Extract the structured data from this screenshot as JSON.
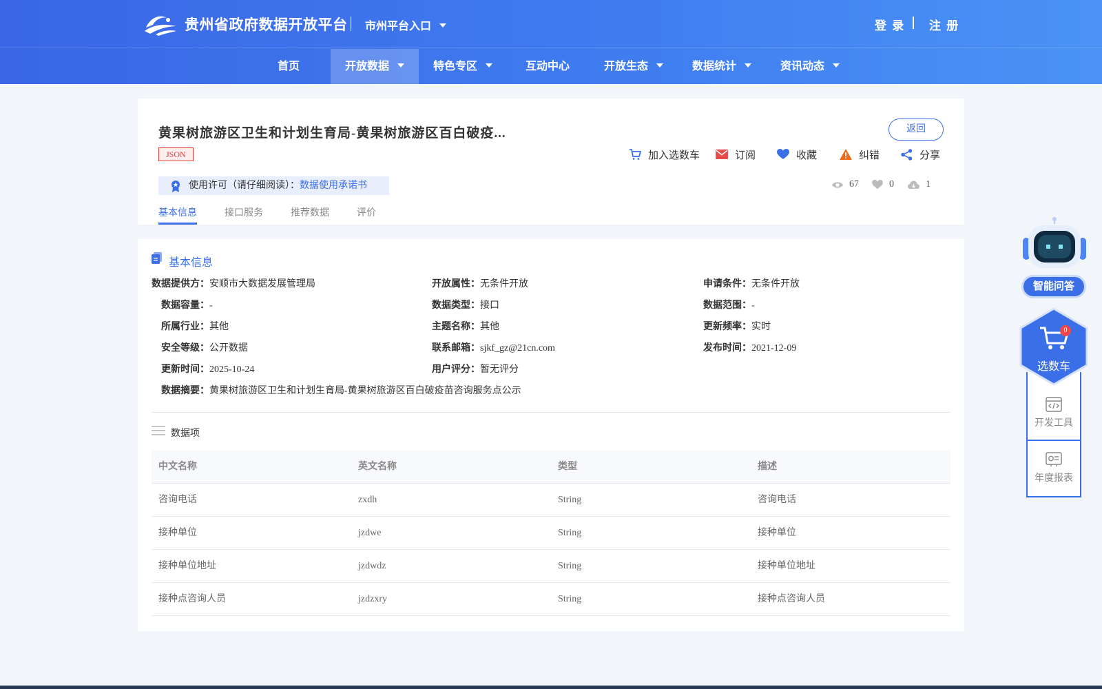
{
  "header": {
    "site_title": "贵州省政府数据开放平台",
    "city_entry": "市州平台入口",
    "login": "登 录",
    "register": "注 册"
  },
  "nav": {
    "items": [
      {
        "label": "首页"
      },
      {
        "label": "开放数据"
      },
      {
        "label": "特色专区"
      },
      {
        "label": "互动中心"
      },
      {
        "label": "开放生态"
      },
      {
        "label": "数据统计"
      },
      {
        "label": "资讯动态"
      }
    ],
    "active": "开放数据"
  },
  "dataset": {
    "title": "黄果树旅游区卫生和计划生育局-黄果树旅游区百白破疫...",
    "format": "JSON",
    "back_label": "返回",
    "actions": {
      "add_cart": "加入选数车",
      "subscribe": "订阅",
      "favorite": "收藏",
      "report_error": "纠错",
      "share": "分享"
    },
    "license_label": "使用许可（请仔细阅读）：",
    "license_link": "数据使用承诺书",
    "stats": {
      "views": "67",
      "likes": "0",
      "downloads": "1"
    },
    "tabs": [
      "基本信息",
      "接口服务",
      "推荐数据",
      "评价"
    ]
  },
  "basic_info": {
    "section_title": "基本信息",
    "fields": {
      "provider": {
        "label": "数据提供方：",
        "value": "安顺市大数据发展管理局"
      },
      "open_attr": {
        "label": "开放属性：",
        "value": "无条件开放"
      },
      "apply_cond": {
        "label": "申请条件：",
        "value": "无条件开放"
      },
      "capacity": {
        "label": "数据容量：",
        "value": "-"
      },
      "data_type": {
        "label": "数据类型：",
        "value": "接口"
      },
      "data_range": {
        "label": "数据范围：",
        "value": "-"
      },
      "industry": {
        "label": "所属行业：",
        "value": "其他"
      },
      "theme": {
        "label": "主题名称：",
        "value": "其他"
      },
      "frequency": {
        "label": "更新频率：",
        "value": "实时"
      },
      "security": {
        "label": "安全等级：",
        "value": "公开数据"
      },
      "email": {
        "label": "联系邮箱：",
        "value": "sjkf_gz@21cn.com"
      },
      "publish_time": {
        "label": "发布时间：",
        "value": "2021-12-09"
      },
      "update_time": {
        "label": "更新时间：",
        "value": "2025-10-24"
      },
      "rating": {
        "label": "用户评分：",
        "value": "暂无评分"
      },
      "summary": {
        "label": "数据摘要：",
        "value": "黄果树旅游区卫生和计划生育局-黄果树旅游区百白破疫苗咨询服务点公示"
      }
    }
  },
  "data_items": {
    "title": "数据项",
    "columns": [
      "中文名称",
      "英文名称",
      "类型",
      "描述"
    ],
    "rows": [
      [
        "咨询电话",
        "zxdh",
        "String",
        "咨询电话"
      ],
      [
        "接种单位",
        "jzdwe",
        "String",
        "接种单位"
      ],
      [
        "接种单位地址",
        "jzdwdz",
        "String",
        "接种单位地址"
      ],
      [
        "接种点咨询人员",
        "jzdzxry",
        "String",
        "接种点咨询人员"
      ]
    ]
  },
  "sidebar": {
    "ai_label": "智能问答",
    "cart_label": "选数车",
    "cart_count": "0",
    "dev_tools": "开发工具",
    "annual_report": "年度报表"
  },
  "colors": {
    "primary": "#3b6fe8",
    "header_start": "#3a66e6",
    "header_end": "#4a93f5",
    "badge_red": "#e63c3c",
    "page_bg": "#f2f5f9"
  }
}
